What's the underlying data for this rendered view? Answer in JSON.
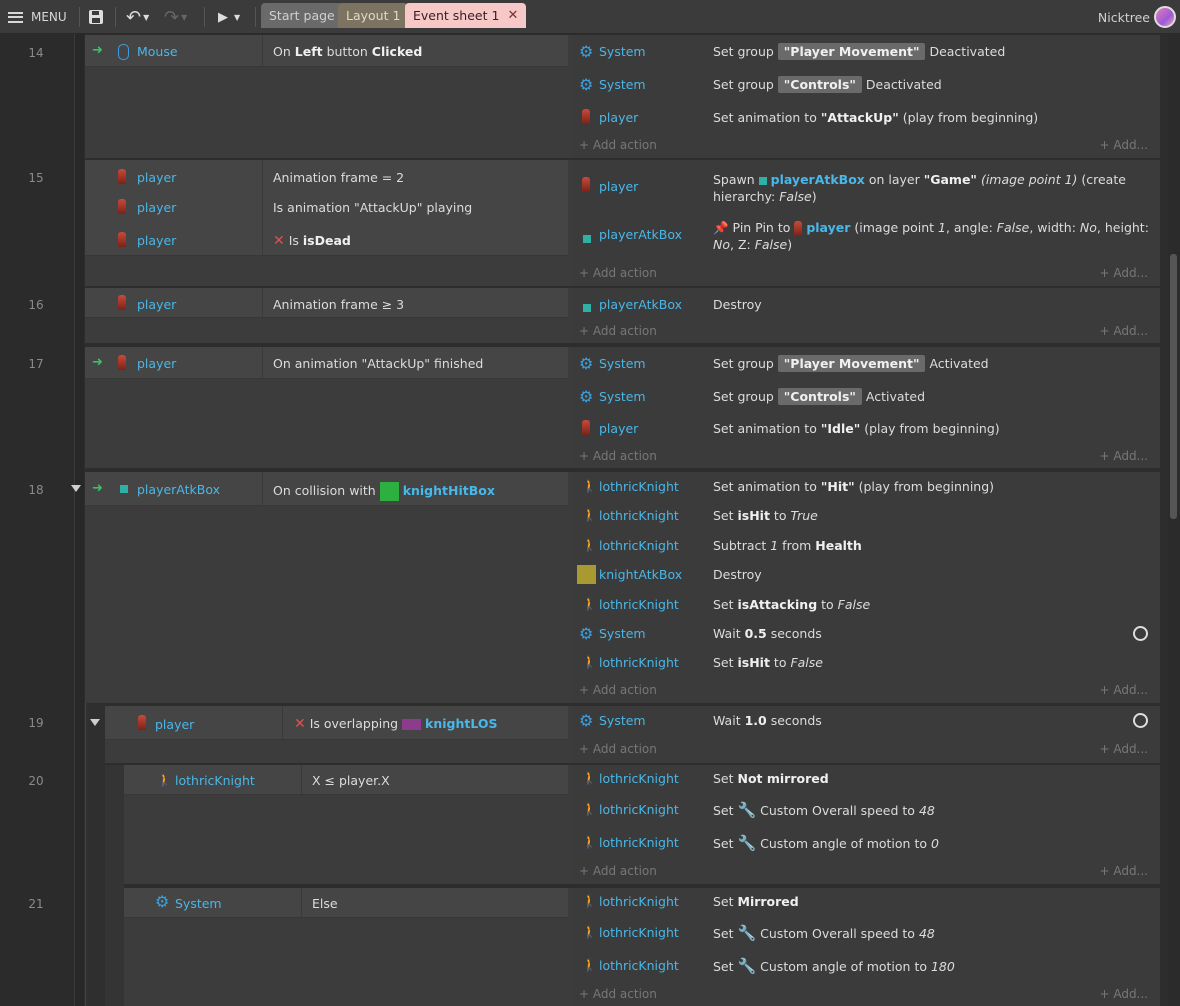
{
  "toolbar": {
    "menu_label": "MENU",
    "save_icon": "save-icon",
    "undo_icon": "undo-icon",
    "redo_icon": "redo-icon",
    "play_icon": "play-icon"
  },
  "tabs": [
    {
      "label": "Start page"
    },
    {
      "label": "Layout 1"
    },
    {
      "label": "Event sheet 1",
      "close": "✕"
    }
  ],
  "user": {
    "name": "Nicktree"
  },
  "common": {
    "add_action": "+ Add action",
    "add_more": "+ Add...",
    "system": "System",
    "player": "player",
    "playerAtkBox": "playerAtkBox",
    "lothricKnight": "lothricKnight",
    "knightAtkBox": "knightAtkBox",
    "mouse": "Mouse"
  },
  "events": [
    {
      "num": "14",
      "conditions": [
        "On Left button Clicked"
      ],
      "actions": [
        "Set group \"Player Movement\" Deactivated",
        "Set group \"Controls\" Deactivated",
        "Set animation to \"AttackUp\" (play from beginning)"
      ]
    },
    {
      "num": "15",
      "conditions": [
        "Animation frame = 2",
        "Is animation \"AttackUp\" playing",
        "Is isDead"
      ],
      "actions": [
        "Spawn playerAtkBox on layer \"Game\" (image point 1) (create hierarchy: False)",
        "Pin Pin to player (image point 1, angle: False, width: No, height: No, Z: False)"
      ]
    },
    {
      "num": "16",
      "conditions": [
        "Animation frame ≥ 3"
      ],
      "actions": [
        "Destroy"
      ]
    },
    {
      "num": "17",
      "conditions": [
        "On animation \"AttackUp\" finished"
      ],
      "actions": [
        "Set group \"Player Movement\" Activated",
        "Set group \"Controls\" Activated",
        "Set animation to \"Idle\" (play from beginning)"
      ]
    },
    {
      "num": "18",
      "conditions": [
        "On collision with knightHitBox"
      ],
      "actions": [
        "Set animation to \"Hit\" (play from beginning)",
        "Set isHit to True",
        "Subtract 1 from Health",
        "Destroy",
        "Set isAttacking to False",
        "Wait 0.5 seconds",
        "Set isHit to False"
      ]
    },
    {
      "num": "19",
      "conditions": [
        "Is overlapping knightLOS"
      ],
      "actions": [
        "Wait 1.0 seconds"
      ]
    },
    {
      "num": "20",
      "conditions": [
        "X ≤ player.X"
      ],
      "actions": [
        "Set Not mirrored",
        "Set Custom Overall speed to 48",
        "Set Custom angle of motion to 0"
      ]
    },
    {
      "num": "21",
      "conditions": [
        "Else"
      ],
      "actions": [
        "Set Mirrored",
        "Set Custom Overall speed to 48",
        "Set Custom angle of motion to 180"
      ]
    }
  ],
  "colors": {
    "object_link": "#49b7e8",
    "active_tab": "#f6c8c8",
    "trigger_arrow": "#3cc060",
    "invert_x": "#e05050"
  }
}
